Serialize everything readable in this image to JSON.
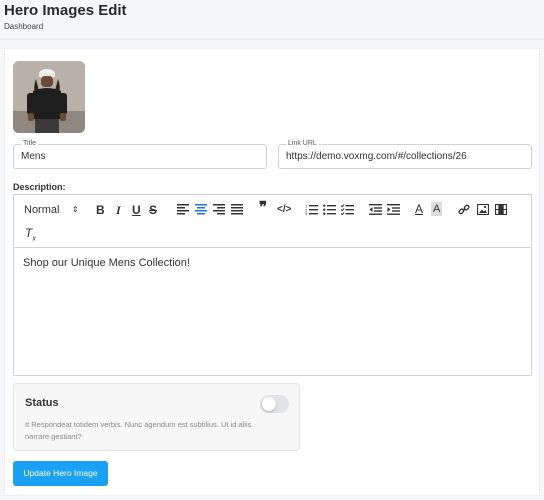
{
  "header": {
    "title": "Hero Images Edit",
    "breadcrumb": "Dashboard"
  },
  "form": {
    "title_label": "Title",
    "title_value": "Mens",
    "link_label": "Link URL",
    "link_value": "https://demo.voxmg.com/#/collections/26",
    "description_label": "Description:"
  },
  "editor": {
    "format_select": "Normal",
    "content": "Shop our Unique Mens Collection!",
    "active_align": "center",
    "accent_color": "#1a73e8"
  },
  "status": {
    "title": "Status",
    "help": "It Respondeat totidem verbis. Nunc agendum est subtilius. Ut id aliis narrare gestiant?",
    "enabled": false
  },
  "submit_label": "Update Hero Image",
  "colors": {
    "primary_button": "#1aa0f5",
    "border": "#cfd3d8"
  }
}
